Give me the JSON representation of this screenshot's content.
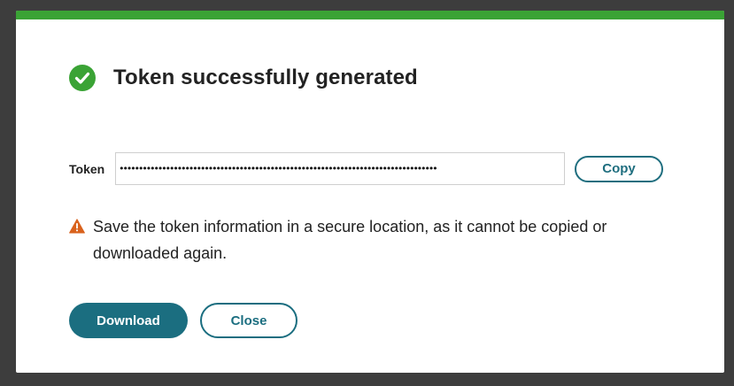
{
  "colors": {
    "accent_bar": "#3aa335",
    "success": "#3aa335",
    "primary": "#1b6e80",
    "warning": "#d9621d",
    "backdrop": "#3d3d3d"
  },
  "dialog": {
    "title": "Token successfully generated",
    "success_icon": "check-circle-icon",
    "token": {
      "label": "Token",
      "masked_value": "••••••••••••••••••••••••••••••••••••••••••••••••••••••••••••••••••••••••••••••••••",
      "copy_label": "Copy"
    },
    "warning": {
      "icon": "warning-triangle-icon",
      "text": "Save the token information in a secure location, as it cannot be copied or downloaded again."
    },
    "actions": {
      "download_label": "Download",
      "close_label": "Close"
    }
  }
}
